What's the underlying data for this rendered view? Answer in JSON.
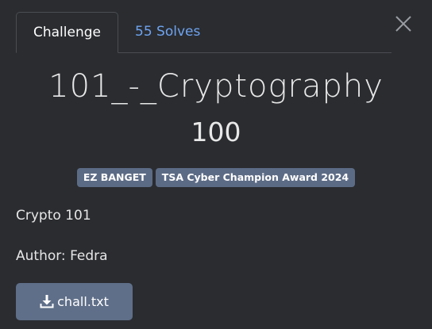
{
  "tabs": {
    "challenge_label": "Challenge",
    "solves_label": "55 Solves"
  },
  "challenge": {
    "name": "101_-_Cryptography",
    "points": "100",
    "tags": [
      "EZ BANGET",
      "TSA Cyber Champion Award 2024"
    ],
    "description": "Crypto 101",
    "author": "Author: Fedra"
  },
  "files": [
    {
      "name": "chall.txt",
      "icon": "download-icon"
    }
  ],
  "icons": {
    "close": "close-icon"
  },
  "colors": {
    "background": "#2a2c30",
    "tag": "#5c6b85",
    "button": "#5f6f89",
    "link": "#6ea3f0"
  }
}
